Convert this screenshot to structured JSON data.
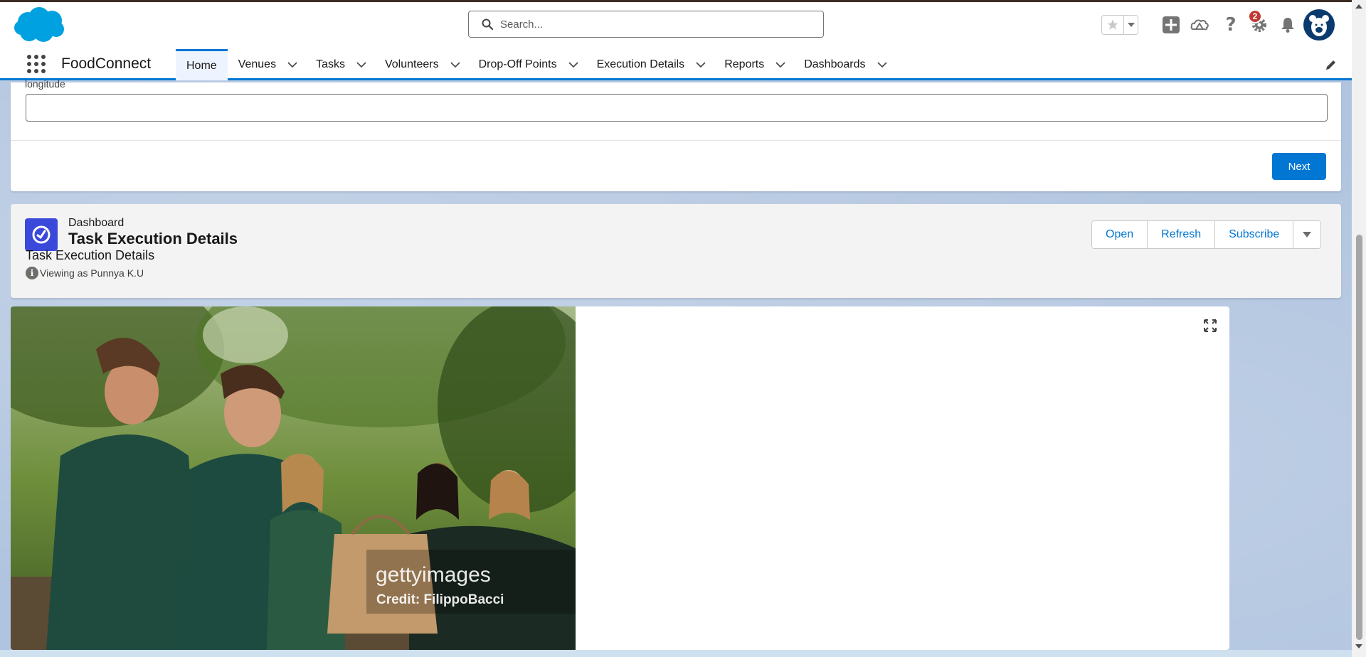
{
  "header": {
    "search_placeholder": "Search...",
    "notification_count": "2"
  },
  "nav": {
    "app_name": "FoodConnect",
    "items": [
      {
        "label": "Home",
        "active": true
      },
      {
        "label": "Venues"
      },
      {
        "label": "Tasks"
      },
      {
        "label": "Volunteers"
      },
      {
        "label": "Drop-Off Points"
      },
      {
        "label": "Execution Details"
      },
      {
        "label": "Reports"
      },
      {
        "label": "Dashboards"
      }
    ]
  },
  "flow": {
    "field_label": "longitude",
    "field_value": "",
    "next_label": "Next"
  },
  "dashboard": {
    "type_label": "Dashboard",
    "title": "Task Execution Details",
    "subtitle": "Task Execution Details",
    "viewing_as": "Viewing as Punnya K.U",
    "buttons": {
      "open": "Open",
      "refresh": "Refresh",
      "subscribe": "Subscribe"
    }
  },
  "image_widget": {
    "watermark": "gettyimages",
    "credit": "Credit: FilippoBacci"
  },
  "colors": {
    "brand": "#0176d3",
    "dashboard_icon": "#3a49da",
    "badge": "#c23934"
  }
}
